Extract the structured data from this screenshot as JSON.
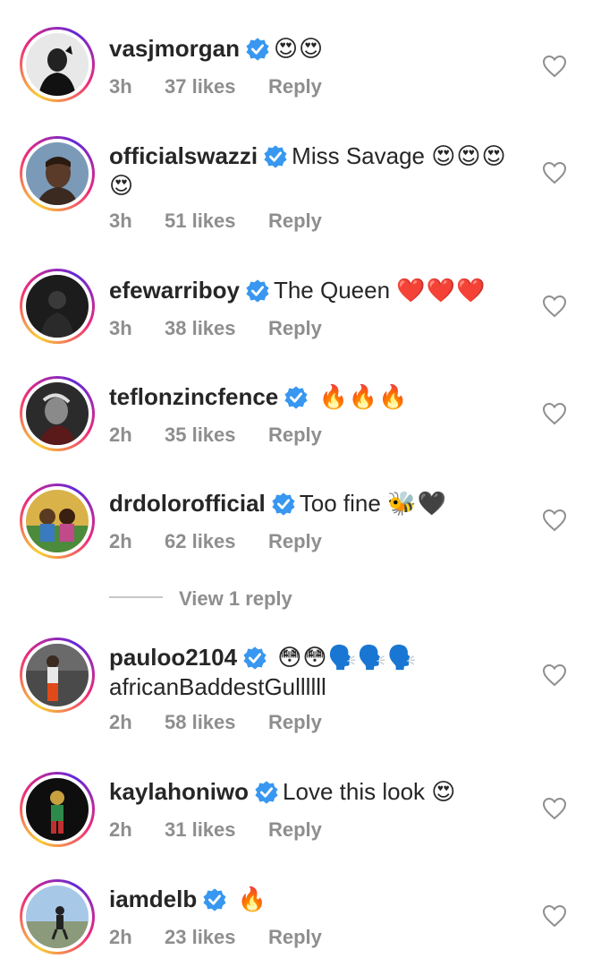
{
  "comments": [
    {
      "username": "vasjmorgan",
      "text": "",
      "emoji": "😍😍",
      "time": "3h",
      "likes": "37 likes",
      "reply": "Reply",
      "verified": true
    },
    {
      "username": "officialswazzi",
      "text": "Miss Savage",
      "emoji": "😍😍😍",
      "emoji2": "😍",
      "time": "3h",
      "likes": "51 likes",
      "reply": "Reply",
      "verified": true
    },
    {
      "username": "efewarriboy",
      "text": "The Queen",
      "emoji": "❤️❤️❤️",
      "time": "3h",
      "likes": "38 likes",
      "reply": "Reply",
      "verified": true
    },
    {
      "username": "teflonzincfence",
      "text": "",
      "emoji": "🔥🔥🔥",
      "time": "2h",
      "likes": "35 likes",
      "reply": "Reply",
      "verified": true
    },
    {
      "username": "drdolorofficial",
      "text": "Too fine",
      "emoji": "🐝🖤",
      "time": "2h",
      "likes": "62 likes",
      "reply": "Reply",
      "verified": true
    },
    {
      "username": "pauloo2104",
      "text": "",
      "emoji": "😳😳🗣️🗣️🗣️",
      "text2": "africanBaddestGullllll",
      "time": "2h",
      "likes": "58 likes",
      "reply": "Reply",
      "verified": true
    },
    {
      "username": "kaylahoniwo",
      "text": "Love this look",
      "emoji": "😍",
      "time": "2h",
      "likes": "31 likes",
      "reply": "Reply",
      "verified": true
    },
    {
      "username": "iamdelb",
      "text": "",
      "emoji": "🔥",
      "time": "2h",
      "likes": "23 likes",
      "reply": "Reply",
      "verified": true
    }
  ],
  "view_replies": "View 1 reply",
  "colors": {
    "verified": "#3897f0",
    "meta": "#8e8e8e",
    "text": "#262626"
  }
}
